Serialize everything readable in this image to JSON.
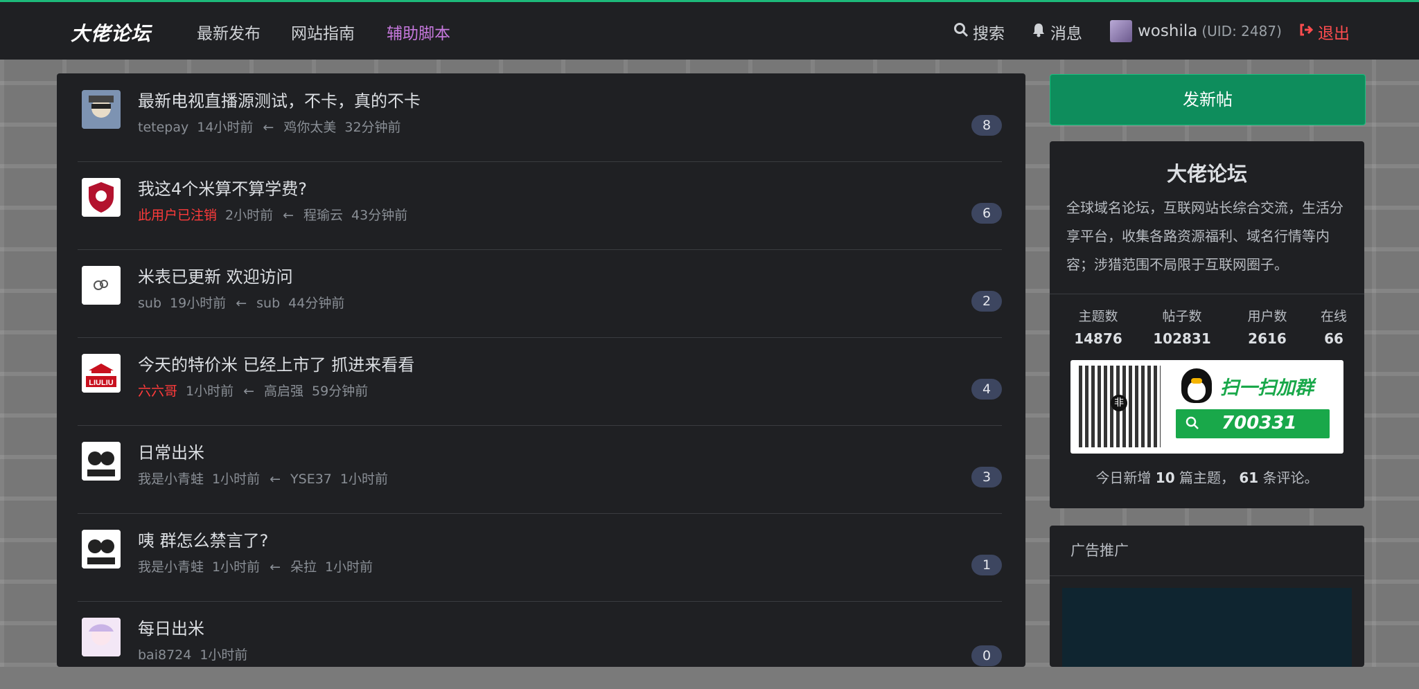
{
  "nav": {
    "logo": "大佬论坛",
    "links": [
      "最新发布",
      "网站指南",
      "辅助脚本"
    ],
    "search": "搜索",
    "messages": "消息",
    "username": "woshila",
    "uid": "(UID: 2487)",
    "logout": "退出"
  },
  "topics": [
    {
      "title": "最新电视直播源测试，不卡，真的不卡",
      "author": "tetepay",
      "time": "14小时前",
      "last_user": "鸡你太美",
      "last_time": "32分钟前",
      "count": "8",
      "author_red": false
    },
    {
      "title": "我这4个米算不算学费?",
      "author": "此用户已注销",
      "time": "2小时前",
      "last_user": "程瑜云",
      "last_time": "43分钟前",
      "count": "6",
      "author_red": true
    },
    {
      "title": "米表已更新 欢迎访问",
      "author": "sub",
      "time": "19小时前",
      "last_user": "sub",
      "last_time": "44分钟前",
      "count": "2",
      "author_red": false
    },
    {
      "title": "今天的特价米 已经上市了 抓进来看看",
      "author": "六六哥",
      "time": "1小时前",
      "last_user": "高启强",
      "last_time": "59分钟前",
      "count": "4",
      "author_red": true
    },
    {
      "title": "日常出米",
      "author": "我是小青蛙",
      "time": "1小时前",
      "last_user": "YSE37",
      "last_time": "1小时前",
      "count": "3",
      "author_red": false
    },
    {
      "title": "咦 群怎么禁言了?",
      "author": "我是小青蛙",
      "time": "1小时前",
      "last_user": "朵拉",
      "last_time": "1小时前",
      "count": "1",
      "author_red": false
    },
    {
      "title": "每日出米",
      "author": "bai8724",
      "time": "1小时前",
      "last_user": "",
      "last_time": "",
      "count": "0",
      "author_red": false
    }
  ],
  "sidebar": {
    "new_post": "发新帖",
    "forum_name": "大佬论坛",
    "description": "全球域名论坛，互联网站长综合交流，生活分享平台，收集各路资源福利、域名行情等内容；涉猎范围不局限于互联网圈子。",
    "stats": [
      {
        "label": "主题数",
        "value": "14876"
      },
      {
        "label": "帖子数",
        "value": "102831"
      },
      {
        "label": "用户数",
        "value": "2616"
      },
      {
        "label": "在线",
        "value": "66"
      }
    ],
    "qr": {
      "scan_text": "扫一扫加群",
      "group_number": "700331",
      "center_mark": "非"
    },
    "today": {
      "prefix": "今日新增",
      "topics": "10",
      "mid": "篇主题，",
      "comments": "61",
      "suffix": "条评论。"
    },
    "ad_title": "广告推广"
  },
  "colors": {
    "accent": "#1db97a",
    "active_nav": "#c678dd",
    "danger": "#ff4d4f"
  }
}
